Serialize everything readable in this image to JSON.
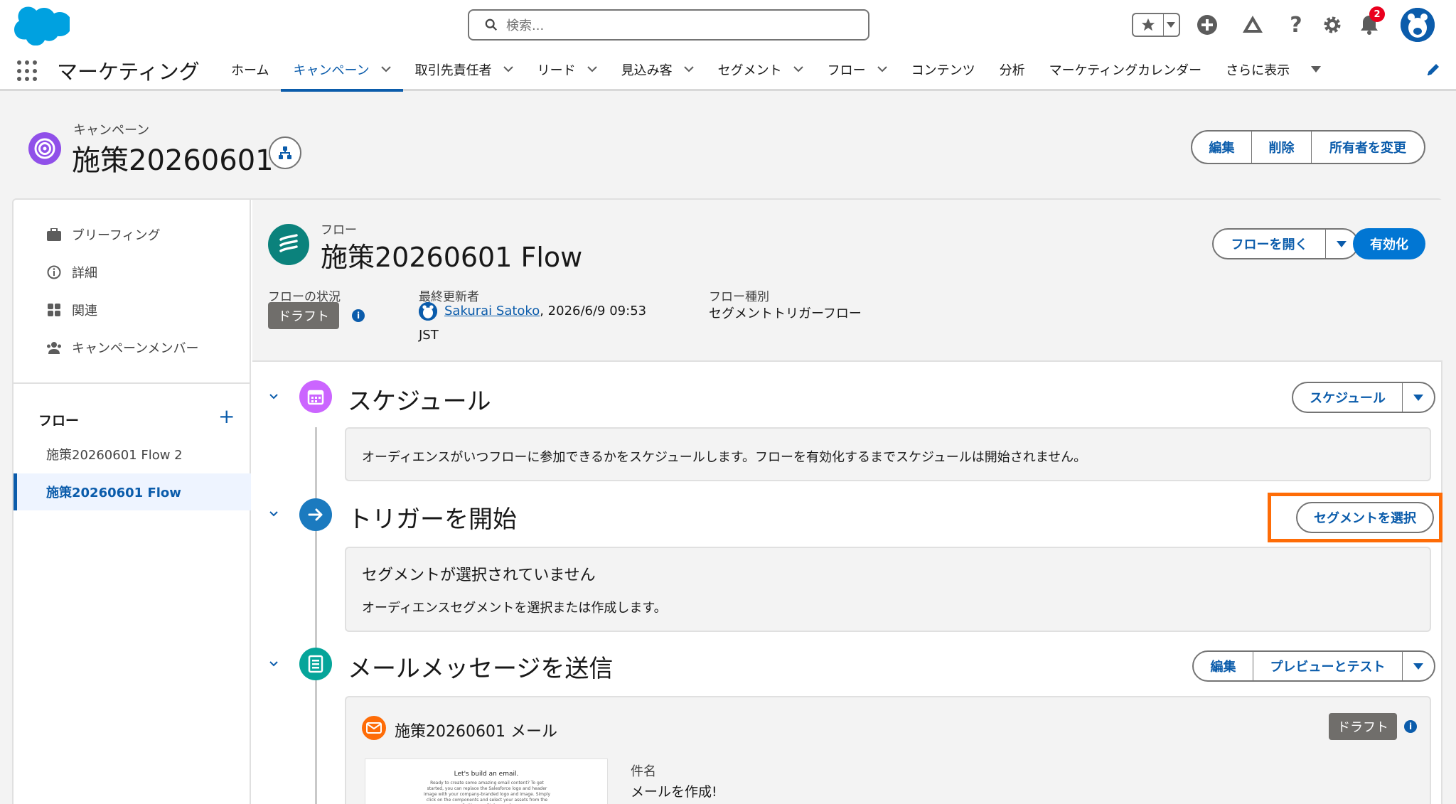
{
  "header": {
    "search_placeholder": "検索...",
    "notification_count": "2"
  },
  "nav": {
    "app_name": "マーケティング",
    "items": [
      {
        "label": "ホーム",
        "has_menu": false
      },
      {
        "label": "キャンペーン",
        "has_menu": true,
        "active": true
      },
      {
        "label": "取引先責任者",
        "has_menu": true
      },
      {
        "label": "リード",
        "has_menu": true
      },
      {
        "label": "見込み客",
        "has_menu": true
      },
      {
        "label": "セグメント",
        "has_menu": true
      },
      {
        "label": "フロー",
        "has_menu": true
      },
      {
        "label": "コンテンツ",
        "has_menu": false
      },
      {
        "label": "分析",
        "has_menu": false
      },
      {
        "label": "マーケティングカレンダー",
        "has_menu": false
      }
    ],
    "more_label": "さらに表示"
  },
  "record": {
    "type_label": "キャンペーン",
    "name": "施策20260601",
    "actions": [
      "編集",
      "削除",
      "所有者を変更"
    ]
  },
  "left_nav": {
    "items": [
      "ブリーフィング",
      "詳細",
      "関連",
      "キャンペーンメンバー"
    ],
    "flow_heading": "フロー",
    "flows": [
      "施策20260601 Flow 2",
      "施策20260601 Flow"
    ],
    "selected_flow_index": 1
  },
  "flow": {
    "type_label": "フロー",
    "name": "施策20260601 Flow",
    "open_label": "フローを開く",
    "activate_label": "有効化",
    "status_label": "フローの状況",
    "status_value": "ドラフト",
    "modified_label": "最終更新者",
    "modified_user": "Sakurai Satoko",
    "modified_date": ", 2026/6/9 09:53",
    "modified_tz": "JST",
    "kind_label": "フロー種別",
    "kind_value": "セグメントトリガーフロー"
  },
  "steps": {
    "schedule": {
      "title": "スケジュール",
      "button": "スケジュール",
      "desc": "オーディエンスがいつフローに参加できるかをスケジュールします。フローを有効化するまでスケジュールは開始されません。"
    },
    "trigger": {
      "title": "トリガーを開始",
      "button": "セグメントを選択",
      "empty_title": "セグメントが選択されていません",
      "empty_desc": "オーディエンスセグメントを選択または作成します。"
    },
    "email": {
      "title": "メールメッセージを送信",
      "edit_label": "編集",
      "preview_label": "プレビューとテスト",
      "email_name": "施策20260601 メール",
      "status": "ドラフト",
      "subject_label": "件名",
      "subject_value": "メールを作成!",
      "thumb_title": "Let's build an email.",
      "thumb_body": "Ready to create some amazing email content? To get started, you can replace the Salesforce logo and header image with your company-branded logo and image. Simply click on the components and select your assets from the Settings or Style panel."
    }
  },
  "colors": {
    "brand": "#0b5cab",
    "primary_button": "#0176d3",
    "highlight": "#fe6c07"
  }
}
